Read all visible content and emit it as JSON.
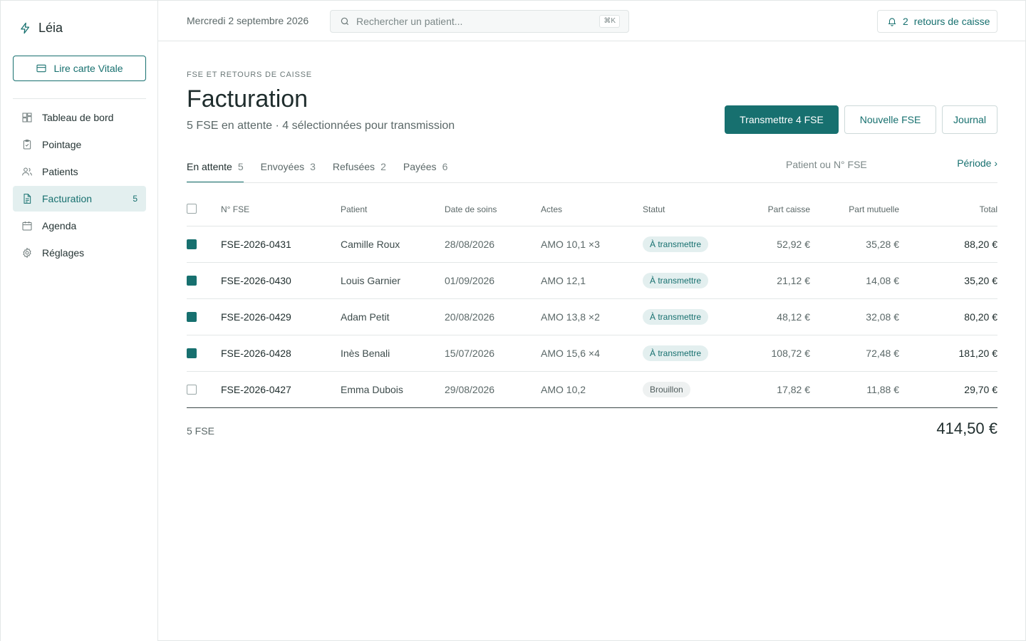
{
  "app": {
    "name": "Léia"
  },
  "sidebar": {
    "vitale_button": "Lire carte Vitale",
    "items": [
      {
        "label": "Tableau de bord",
        "icon": "dashboard-icon",
        "active": false,
        "badge": ""
      },
      {
        "label": "Pointage",
        "icon": "clipboard-icon",
        "active": false,
        "badge": ""
      },
      {
        "label": "Patients",
        "icon": "users-icon",
        "active": false,
        "badge": ""
      },
      {
        "label": "Facturation",
        "icon": "document-icon",
        "active": true,
        "badge": "5"
      },
      {
        "label": "Agenda",
        "icon": "calendar-icon",
        "active": false,
        "badge": ""
      },
      {
        "label": "Réglages",
        "icon": "gear-icon",
        "active": false,
        "badge": ""
      }
    ]
  },
  "topbar": {
    "date": "Mercredi 2 septembre 2026",
    "search_placeholder": "Rechercher un patient...",
    "search_shortcut": "⌘K",
    "notif_count": "2",
    "notif_label": "retours de caisse"
  },
  "header": {
    "eyebrow": "FSE ET RETOURS DE CAISSE",
    "title": "Facturation",
    "subtitle": "5 FSE en attente · 4 sélectionnées pour transmission",
    "primary_button": "Transmettre 4 FSE",
    "secondary_button": "Nouvelle FSE",
    "ghost_button": "Journal"
  },
  "tabs": [
    {
      "label": "En attente",
      "count": "5",
      "active": true
    },
    {
      "label": "Envoyées",
      "count": "3",
      "active": false
    },
    {
      "label": "Refusées",
      "count": "2",
      "active": false
    },
    {
      "label": "Payées",
      "count": "6",
      "active": false
    }
  ],
  "filter": {
    "placeholder": "Patient ou N° FSE",
    "periode": "Période ›"
  },
  "table": {
    "columns": {
      "fse": "N° FSE",
      "patient": "Patient",
      "date": "Date de soins",
      "actes": "Actes",
      "statut": "Statut",
      "caisse": "Part caisse",
      "mutuelle": "Part mutuelle",
      "total": "Total"
    },
    "rows": [
      {
        "checked": true,
        "fse": "FSE-2026-0431",
        "patient": "Camille Roux",
        "date": "28/08/2026",
        "actes": "AMO 10,1 ×3",
        "statut": "À transmettre",
        "status_kind": "pending",
        "caisse": "52,92 €",
        "mutuelle": "35,28 €",
        "total": "88,20 €"
      },
      {
        "checked": true,
        "fse": "FSE-2026-0430",
        "patient": "Louis Garnier",
        "date": "01/09/2026",
        "actes": "AMO 12,1",
        "statut": "À transmettre",
        "status_kind": "pending",
        "caisse": "21,12 €",
        "mutuelle": "14,08 €",
        "total": "35,20 €"
      },
      {
        "checked": true,
        "fse": "FSE-2026-0429",
        "patient": "Adam Petit",
        "date": "20/08/2026",
        "actes": "AMO 13,8 ×2",
        "statut": "À transmettre",
        "status_kind": "pending",
        "caisse": "48,12 €",
        "mutuelle": "32,08 €",
        "total": "80,20 €"
      },
      {
        "checked": true,
        "fse": "FSE-2026-0428",
        "patient": "Inès Benali",
        "date": "15/07/2026",
        "actes": "AMO 15,6 ×4",
        "statut": "À transmettre",
        "status_kind": "pending",
        "caisse": "108,72 €",
        "mutuelle": "72,48 €",
        "total": "181,20 €"
      },
      {
        "checked": false,
        "fse": "FSE-2026-0427",
        "patient": "Emma Dubois",
        "date": "29/08/2026",
        "actes": "AMO 10,2",
        "statut": "Brouillon",
        "status_kind": "draft",
        "caisse": "17,82 €",
        "mutuelle": "11,88 €",
        "total": "29,70 €"
      }
    ],
    "footer_count": "5 FSE",
    "footer_total": "414,50 €"
  },
  "colors": {
    "accent": "#17706f",
    "accent_soft": "#e3efef",
    "border": "#e3e7e7"
  }
}
